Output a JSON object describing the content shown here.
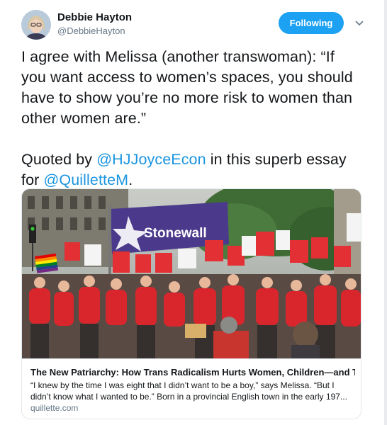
{
  "user": {
    "display_name": "Debbie Hayton",
    "handle": "@DebbieHayton",
    "avatar_icon": "profile-photo"
  },
  "actions": {
    "follow_label": "Following",
    "menu_icon": "chevron-down-icon"
  },
  "tweet": {
    "paragraph1": "I agree with Melissa (another transwoman): “If you want access to women’s spaces, you should have to show you’re no more risk to women than other women are.”",
    "quoted_prefix": "Quoted by ",
    "mention1": "@HJJoyceEcon",
    "quoted_middle": " in this superb essay for ",
    "mention2": "@QuilletteM",
    "quoted_suffix": "."
  },
  "card": {
    "banner_text": "Stonewall",
    "title": "The New Patriarchy: How Trans Radicalism Hurts Women, Children—and Tra...",
    "description": "“I knew by the time I was eight that I didn’t want to be a boy,” says Melissa. “But I didn’t know what I wanted to be.” Born in a provincial English town in the early 197...",
    "domain": "quillette.com"
  },
  "colors": {
    "accent": "#1da1f2",
    "link": "#1b95e0",
    "text": "#14171a",
    "muted": "#657786",
    "banner": "#4b3a8c",
    "crowd_shirt": "#d8262c"
  }
}
